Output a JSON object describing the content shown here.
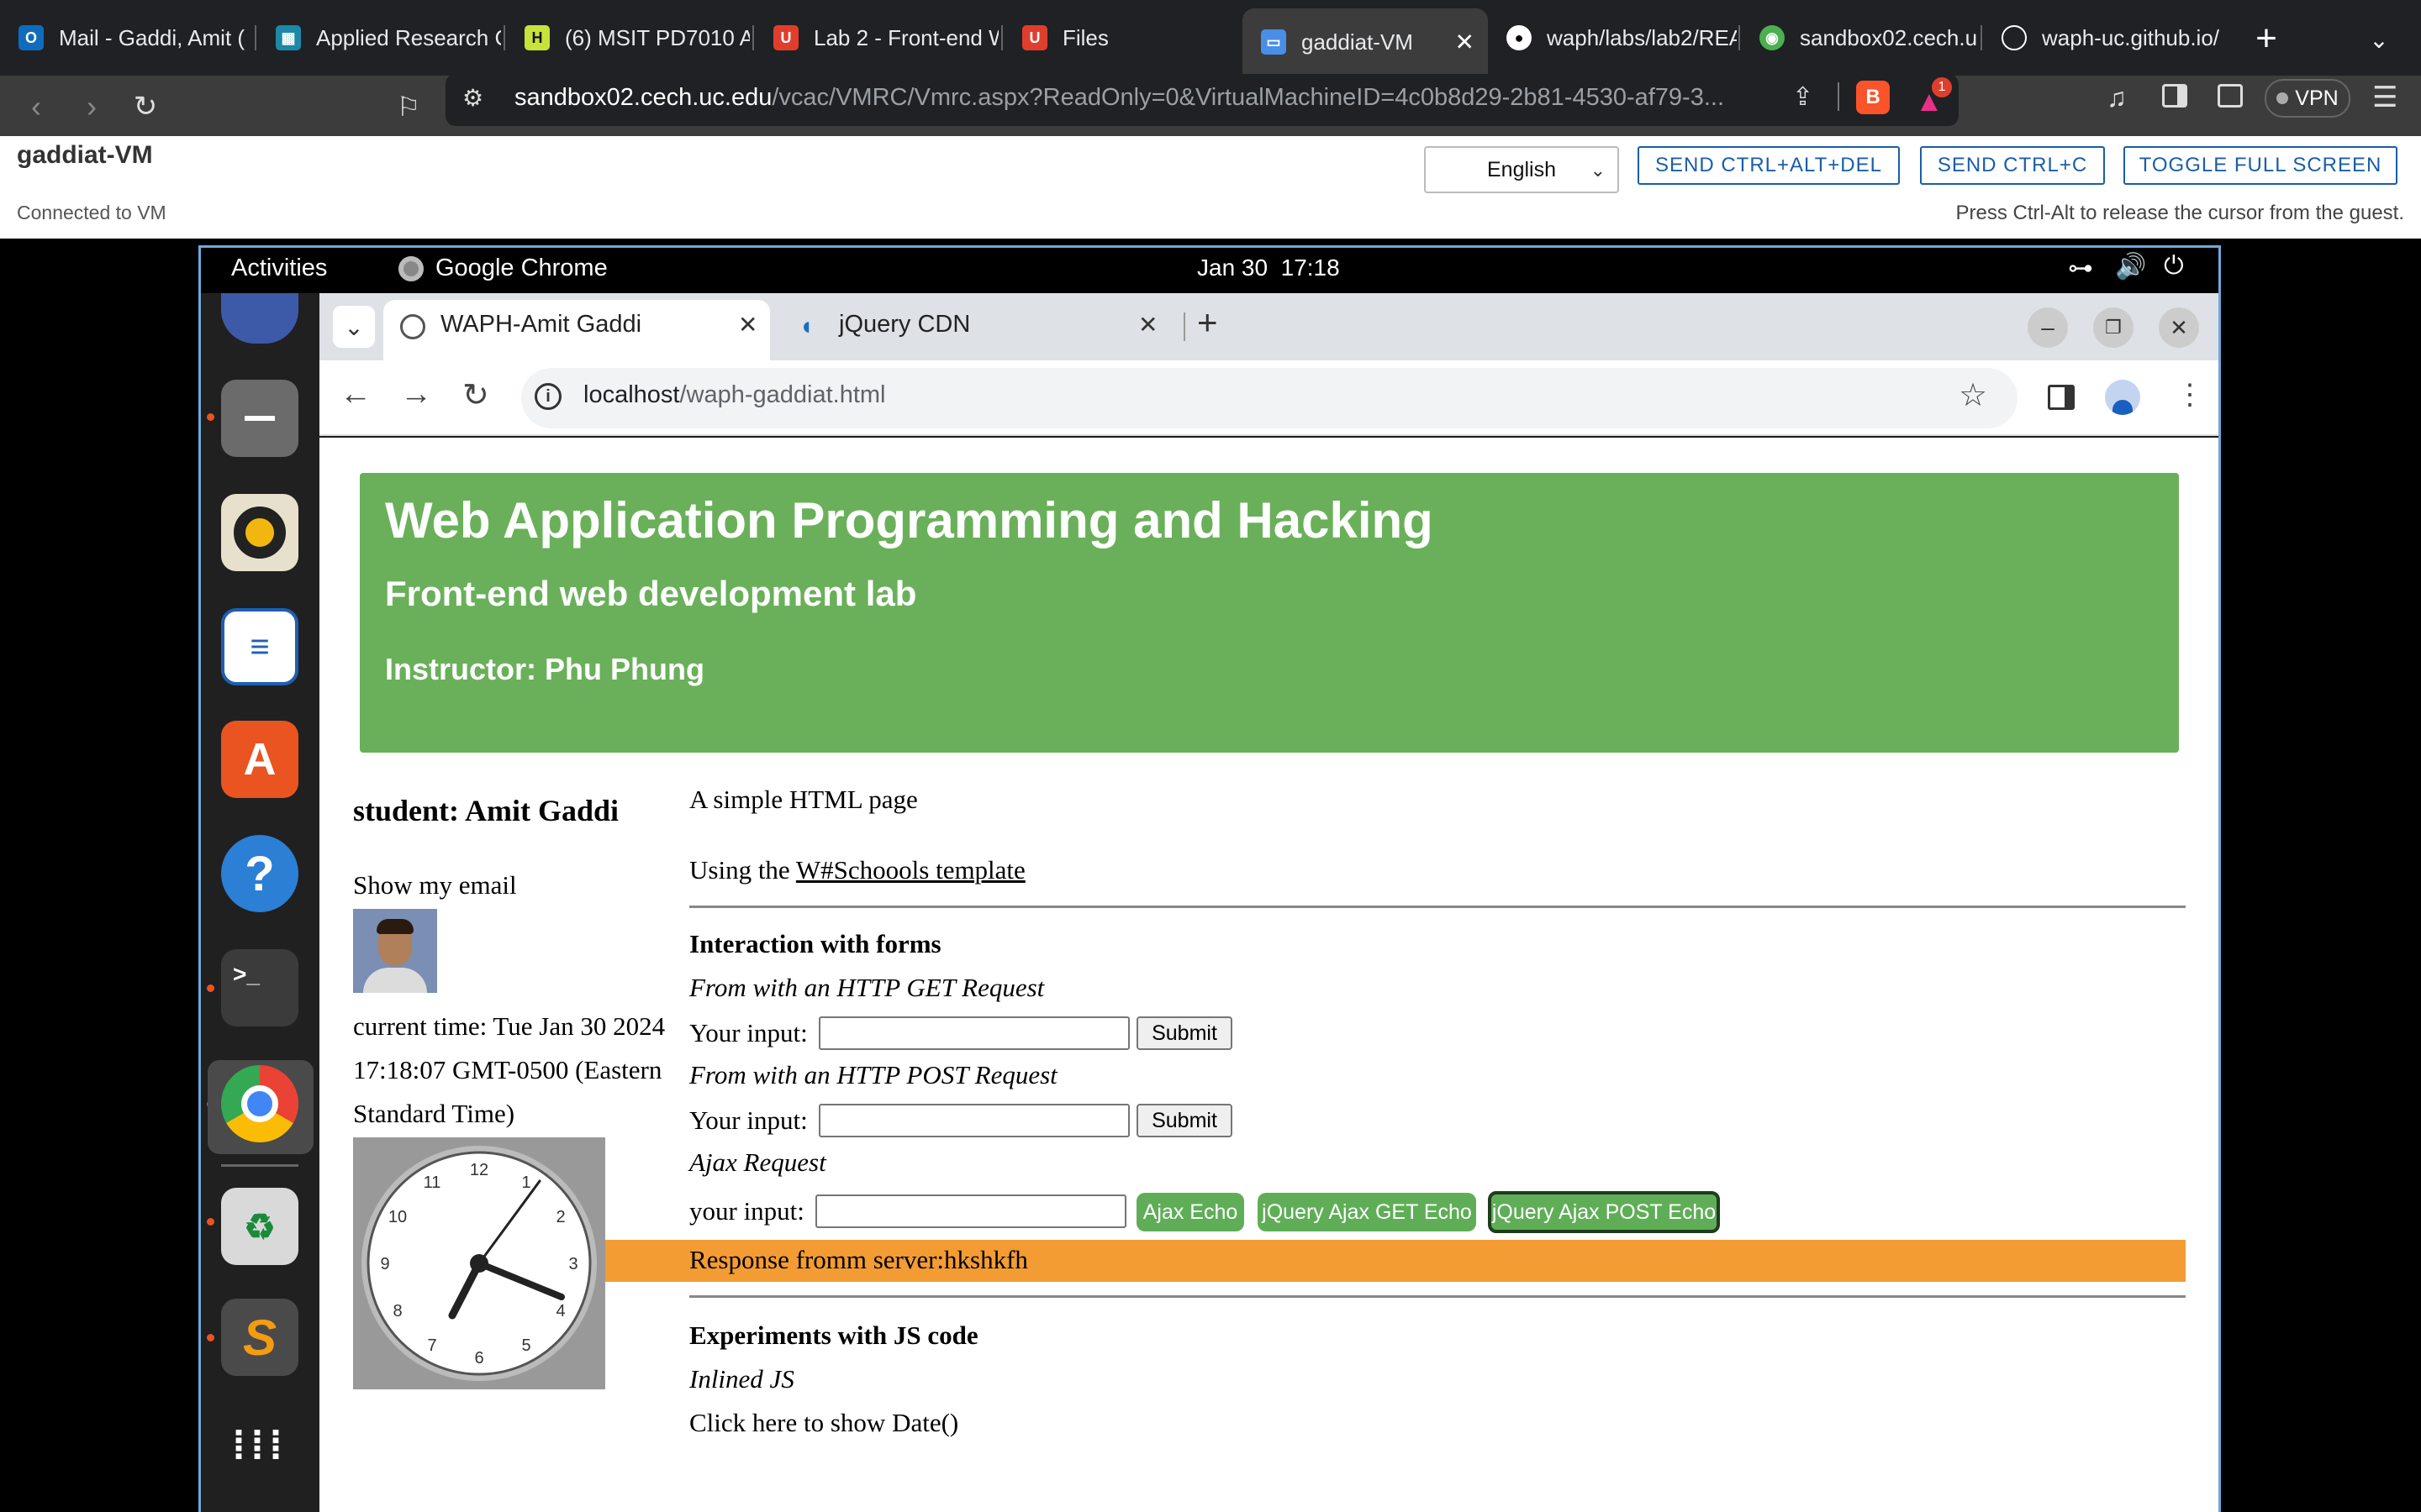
{
  "host": {
    "tabs": [
      {
        "label": "Mail - Gaddi, Amit (",
        "icon": "outlook-icon",
        "color": "#0f6cbd"
      },
      {
        "label": "Applied Research C",
        "icon": "research-icon",
        "color": "#1e88a8"
      },
      {
        "label": "(6) MSIT PD7010 A",
        "icon": "msit-icon",
        "color": "#c7e23a"
      },
      {
        "label": "Lab 2 - Front-end W",
        "icon": "uc-canvas-icon",
        "color": "#e03e2d"
      },
      {
        "label": "Files",
        "icon": "uc-canvas-icon",
        "color": "#e03e2d"
      },
      {
        "label": "gaddiat-VM",
        "icon": "monitor-icon",
        "color": "#4a8fe7"
      },
      {
        "label": "waph/labs/lab2/REA",
        "icon": "github-icon",
        "color": "#ffffff"
      },
      {
        "label": "sandbox02.cech.uc",
        "icon": "globe-icon",
        "color": "#4caf50"
      },
      {
        "label": "waph-uc.github.io/",
        "icon": "globe-icon",
        "color": "#ffffff"
      }
    ],
    "url_host": "sandbox02.cech.uc.edu",
    "url_path": "/vcac/VMRC/Vmrc.aspx?ReadOnly=0&VirtualMachineID=4c0b8d29-2b81-4530-af79-3...",
    "vpn_label": "VPN",
    "notification_count": "1"
  },
  "vmrc": {
    "title": "gaddiat-VM",
    "status": "Connected to VM",
    "language": "English",
    "buttons": [
      "SEND CTRL+ALT+DEL",
      "SEND CTRL+C",
      "TOGGLE FULL SCREEN"
    ],
    "hint": "Press Ctrl-Alt to release the cursor from the guest."
  },
  "guest": {
    "activities": "Activities",
    "app_name": "Google Chrome",
    "clock": "Jan 30  17:18",
    "tabs": [
      "WAPH-Amit Gaddi",
      "jQuery CDN"
    ],
    "url_host": "localhost",
    "url_path": "/waph-gaddiat.html"
  },
  "page": {
    "title": "Web Application Programming and Hacking",
    "subtitle": "Front-end web development lab",
    "instructor": "Instructor: Phu Phung",
    "student": "student: Amit Gaddi",
    "show_email": "Show my email",
    "time_line1": "current time: Tue Jan 30 2024",
    "time_line2": "17:18:07 GMT-0500 (Eastern",
    "time_line3": "Standard Time)",
    "simple_page": "A simple HTML page",
    "using_the": "Using the ",
    "template_link": "W#Schoools template",
    "forms_heading": "Interaction with forms",
    "get_label": "From with an HTTP GET Request",
    "your_input": "Your input:",
    "submit": "Submit",
    "post_label": "From with an HTTP POST Request",
    "ajax_label": "Ajax Request",
    "ajax_input_label": "your input:",
    "ajax_echo": "Ajax Echo",
    "jquery_get": "jQuery Ajax GET Echo",
    "jquery_post": "jQuery Ajax POST Echo",
    "response": "Response fromm server:hkshkfh",
    "js_heading": "Experiments with JS code",
    "inlined_js": "Inlined JS",
    "show_date": "Click here to show Date()",
    "clock_numbers": [
      "12",
      "1",
      "2",
      "3",
      "4",
      "5",
      "6",
      "7",
      "8",
      "9",
      "10",
      "11"
    ]
  }
}
